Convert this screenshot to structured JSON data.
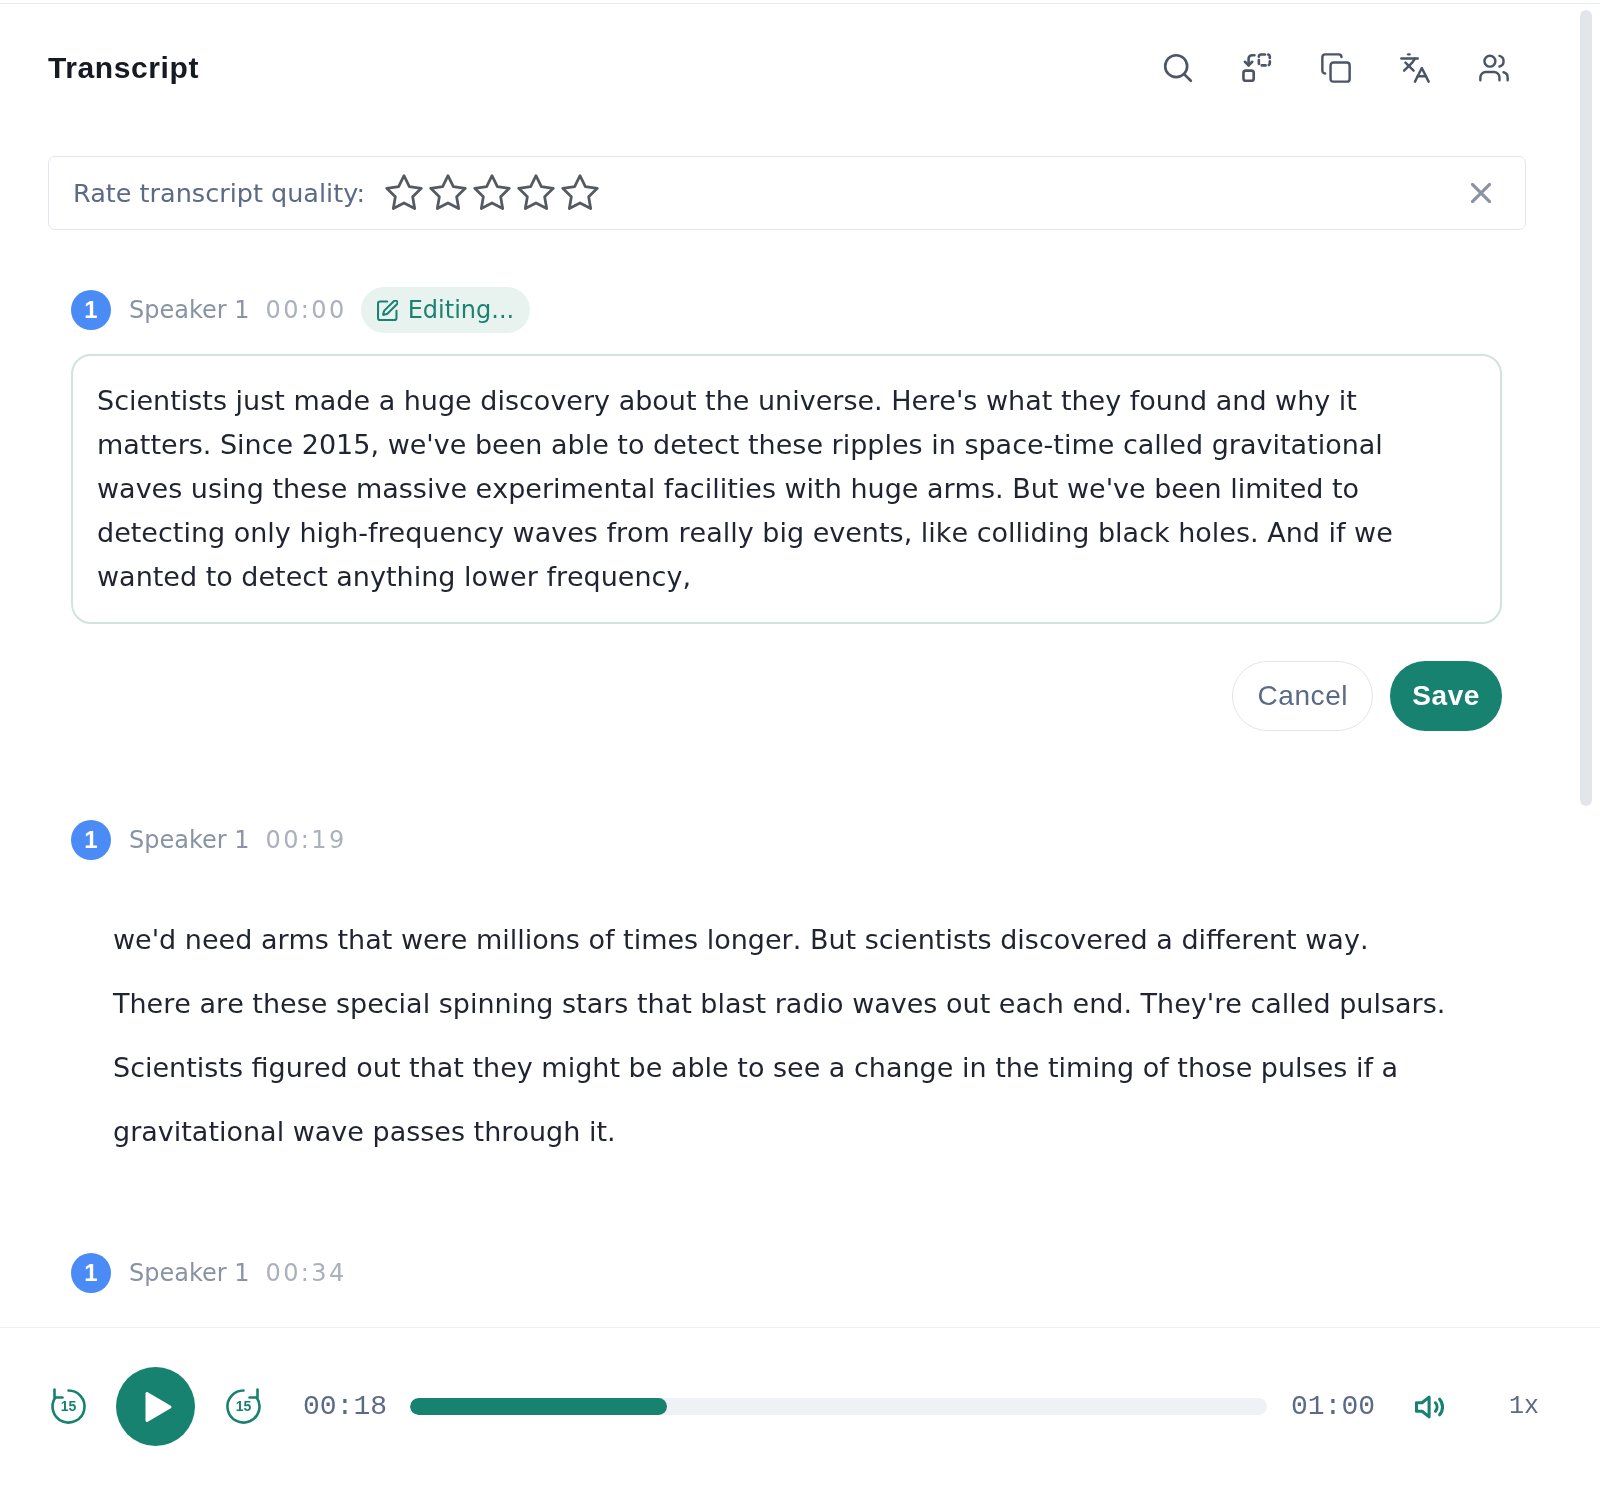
{
  "header": {
    "title": "Transcript"
  },
  "rating": {
    "label": "Rate transcript quality:",
    "stars": 0
  },
  "segments": [
    {
      "badge": "1",
      "color": "#4b8bf5",
      "speaker": "Speaker 1",
      "time": "00:00",
      "editing": true,
      "status": "Editing...",
      "text": "Scientists just made a huge discovery about the universe. Here's what they found and why it matters. Since 2015, we've been able to detect these ripples in space-time called gravitational waves using these massive experimental facilities with huge arms. But we've been limited to detecting only high-frequency waves from really big events, like colliding black holes. And if we wanted to detect anything lower frequency,",
      "buttons": [
        {
          "kind": "cancel",
          "label": "Cancel"
        },
        {
          "kind": "save",
          "label": "Save"
        }
      ]
    },
    {
      "badge": "1",
      "color": "#4b8bf5",
      "speaker": "Speaker 1",
      "time": "00:19",
      "editing": false,
      "text": "we'd need arms that were millions of times longer. But scientists discovered a different way. There are these special spinning stars that blast radio waves out each end. They're called pulsars. Scientists figured out that they might be able to see a change in the timing of those pulses if a gravitational wave passes through it."
    },
    {
      "badge": "1",
      "color": "#4b8bf5",
      "speaker": "Speaker 1",
      "time": "00:34",
      "editing": false
    }
  ],
  "player": {
    "skip_back": "15",
    "playing": false,
    "skip_forward": "15",
    "elapsed": "00:18",
    "level": 0.3,
    "duration": "01:00",
    "speed": "1x"
  }
}
